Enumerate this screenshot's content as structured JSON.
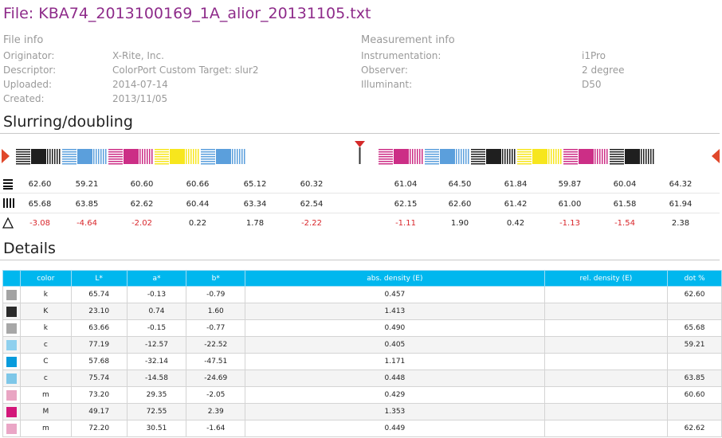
{
  "file_title": "File: KBA74_2013100169_1A_alior_20131105.txt",
  "file_info": {
    "heading": "File info",
    "rows": [
      {
        "label": "Originator:",
        "value": "X-Rite, Inc."
      },
      {
        "label": "Descriptor:",
        "value": "ColorPort Custom Target: slur2"
      },
      {
        "label": "Uploaded:",
        "value": "2014-07-14"
      },
      {
        "label": "Created:",
        "value": "2013/11/05"
      }
    ]
  },
  "measurement_info": {
    "heading": "Measurement info",
    "rows": [
      {
        "label": "Instrumentation:",
        "value": "i1Pro"
      },
      {
        "label": "Observer:",
        "value": "2 degree"
      },
      {
        "label": "Illuminant:",
        "value": "D50"
      }
    ]
  },
  "slurring": {
    "heading": "Slurring/doubling",
    "colors": {
      "k": "#1f1f1f",
      "c": "#5b9fdc",
      "m": "#cc2e86",
      "y": "#f7e61d"
    },
    "left_strip": [
      "k",
      "c",
      "m",
      "y",
      "c"
    ],
    "right_strip": [
      "m",
      "c",
      "k",
      "y",
      "m",
      "k"
    ],
    "horizontal_row": [
      "62.60",
      "59.21",
      "60.60",
      "60.66",
      "65.12",
      "60.32",
      "61.04",
      "64.50",
      "61.84",
      "59.87",
      "60.04",
      "64.32"
    ],
    "vertical_row": [
      "65.68",
      "63.85",
      "62.62",
      "60.44",
      "63.34",
      "62.54",
      "62.15",
      "62.60",
      "61.42",
      "61.00",
      "61.58",
      "61.94"
    ],
    "delta_row": [
      "-3.08",
      "-4.64",
      "-2.02",
      "0.22",
      "1.78",
      "-2.22",
      "-1.11",
      "1.90",
      "0.42",
      "-1.13",
      "-1.54",
      "2.38"
    ],
    "delta_colors": {
      "negative": "#d9262b",
      "positive": "#222222"
    }
  },
  "details": {
    "heading": "Details",
    "header_color": "#00b7ee",
    "columns": [
      "color",
      "L*",
      "a*",
      "b*",
      "abs. density (E)",
      "rel. density (E)",
      "dot %"
    ],
    "rows": [
      {
        "swatch": "#a3a3a3",
        "cells": [
          "k",
          "65.74",
          "-0.13",
          "-0.79",
          "0.457",
          "",
          "62.60"
        ]
      },
      {
        "swatch": "#2b2b2b",
        "cells": [
          "K",
          "23.10",
          "0.74",
          "1.60",
          "1.413",
          "",
          ""
        ]
      },
      {
        "swatch": "#a7a7a7",
        "cells": [
          "k",
          "63.66",
          "-0.15",
          "-0.77",
          "0.490",
          "",
          "65.68"
        ]
      },
      {
        "swatch": "#8fd0ee",
        "cells": [
          "c",
          "77.19",
          "-12.57",
          "-22.52",
          "0.405",
          "",
          "59.21"
        ]
      },
      {
        "swatch": "#079bdc",
        "cells": [
          "C",
          "57.68",
          "-32.14",
          "-47.51",
          "1.171",
          "",
          ""
        ]
      },
      {
        "swatch": "#7ec7e8",
        "cells": [
          "c",
          "75.74",
          "-14.58",
          "-24.69",
          "0.448",
          "",
          "63.85"
        ]
      },
      {
        "swatch": "#e9a5c3",
        "cells": [
          "m",
          "73.20",
          "29.35",
          "-2.05",
          "0.429",
          "",
          "60.60"
        ]
      },
      {
        "swatch": "#d3177a",
        "cells": [
          "M",
          "49.17",
          "72.55",
          "2.39",
          "1.353",
          "",
          ""
        ]
      },
      {
        "swatch": "#eaa6c6",
        "cells": [
          "m",
          "72.20",
          "30.51",
          "-1.64",
          "0.449",
          "",
          "62.62"
        ]
      }
    ]
  }
}
